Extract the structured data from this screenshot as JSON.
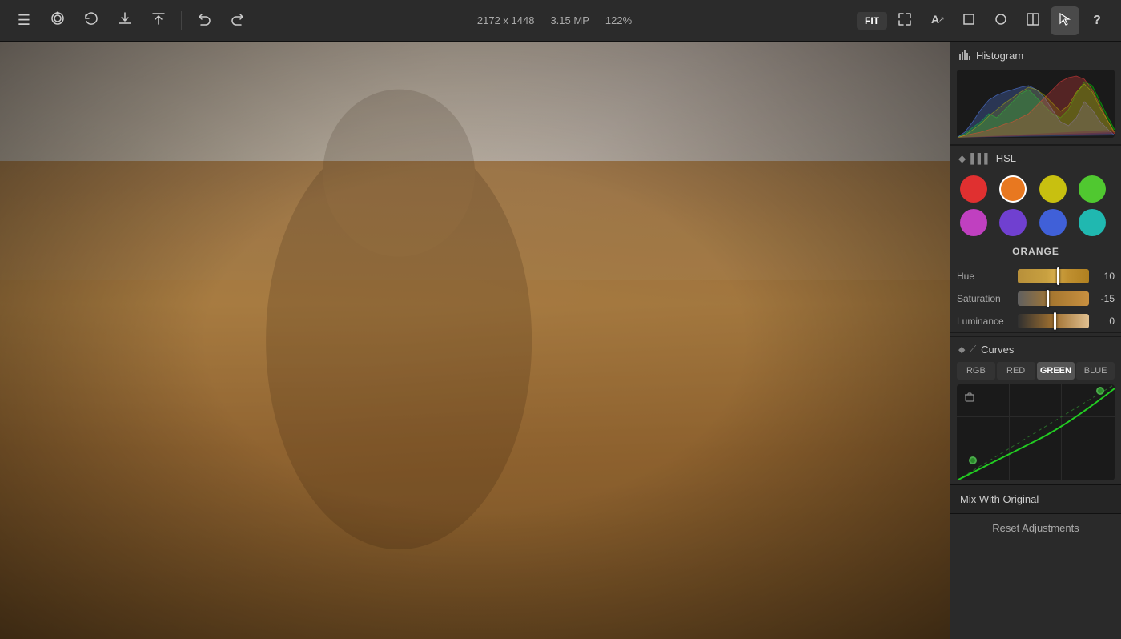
{
  "toolbar": {
    "menu_icon": "☰",
    "snapshot_icon": "◎",
    "history_icon": "↺",
    "download_icon": "⬇",
    "share_icon": "⬆",
    "undo_icon": "←",
    "redo_icon": "→",
    "image_info": {
      "dimensions": "2172 x 1448",
      "megapixels": "3.15 MP",
      "zoom": "122%"
    },
    "fit_label": "FIT",
    "tools": [
      {
        "name": "fullscreen",
        "icon": "⛶"
      },
      {
        "name": "text",
        "icon": "A"
      },
      {
        "name": "crop",
        "icon": "⊡"
      },
      {
        "name": "circle",
        "icon": "○"
      },
      {
        "name": "panel",
        "icon": "▣"
      },
      {
        "name": "select",
        "icon": "⊹"
      },
      {
        "name": "help",
        "icon": "?"
      }
    ]
  },
  "histogram": {
    "label": "Histogram"
  },
  "hsl": {
    "label": "HSL",
    "swatches": [
      {
        "name": "red",
        "color": "#e03030",
        "active": false
      },
      {
        "name": "orange",
        "color": "#e87820",
        "active": true
      },
      {
        "name": "yellow",
        "color": "#c8c010",
        "active": false
      },
      {
        "name": "green",
        "color": "#50c830",
        "active": false
      },
      {
        "name": "purple",
        "color": "#c040c0",
        "active": false
      },
      {
        "name": "violet",
        "color": "#7040d0",
        "active": false
      },
      {
        "name": "blue",
        "color": "#4060d8",
        "active": false
      },
      {
        "name": "teal",
        "color": "#20b8b0",
        "active": false
      }
    ],
    "selected_color": "ORANGE",
    "hue": {
      "label": "Hue",
      "value": 10,
      "thumb_pct": 55
    },
    "saturation": {
      "label": "Saturation",
      "value": -15,
      "thumb_pct": 40
    },
    "luminance": {
      "label": "Luminance",
      "value": 0,
      "thumb_pct": 50
    }
  },
  "curves": {
    "label": "Curves",
    "tabs": [
      "RGB",
      "RED",
      "GREEN",
      "BLUE"
    ],
    "active_tab": "GREEN"
  },
  "bottom": {
    "mix_label": "Mix With Original",
    "reset_label": "Reset Adjustments"
  }
}
